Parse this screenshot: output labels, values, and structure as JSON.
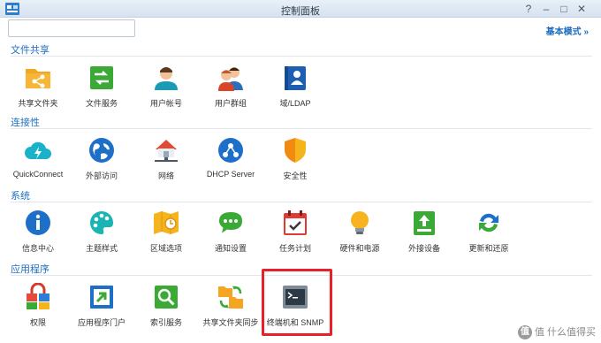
{
  "window": {
    "title": "控制面板",
    "help_icon": "help-icon",
    "minimize_icon": "minimize-icon",
    "maximize_icon": "maximize-icon",
    "close_icon": "close-icon"
  },
  "toolbar": {
    "search_value": "",
    "search_placeholder": "",
    "mode_label": "基本模式",
    "mode_chevron": "»"
  },
  "sections": [
    {
      "title": "文件共享",
      "items": [
        {
          "label": "共享文件夹",
          "icon": "shared-folder-icon"
        },
        {
          "label": "文件服务",
          "icon": "file-services-icon"
        },
        {
          "label": "用户帐号",
          "icon": "user-icon"
        },
        {
          "label": "用户群组",
          "icon": "group-icon"
        },
        {
          "label": "域/LDAP",
          "icon": "domain-ldap-icon"
        }
      ]
    },
    {
      "title": "连接性",
      "items": [
        {
          "label": "QuickConnect",
          "icon": "quickconnect-icon"
        },
        {
          "label": "外部访问",
          "icon": "external-access-icon"
        },
        {
          "label": "网络",
          "icon": "network-icon"
        },
        {
          "label": "DHCP Server",
          "icon": "dhcp-server-icon"
        },
        {
          "label": "安全性",
          "icon": "security-icon"
        }
      ]
    },
    {
      "title": "系统",
      "items": [
        {
          "label": "信息中心",
          "icon": "info-center-icon"
        },
        {
          "label": "主题样式",
          "icon": "theme-icon"
        },
        {
          "label": "区域选项",
          "icon": "regional-options-icon"
        },
        {
          "label": "通知设置",
          "icon": "notification-icon"
        },
        {
          "label": "任务计划",
          "icon": "task-scheduler-icon"
        },
        {
          "label": "硬件和电源",
          "icon": "hardware-power-icon"
        },
        {
          "label": "外接设备",
          "icon": "external-devices-icon"
        },
        {
          "label": "更新和还原",
          "icon": "update-restore-icon"
        }
      ]
    },
    {
      "title": "应用程序",
      "items": [
        {
          "label": "权限",
          "icon": "privileges-icon"
        },
        {
          "label": "应用程序门户",
          "icon": "application-portal-icon"
        },
        {
          "label": "索引服务",
          "icon": "indexing-service-icon"
        },
        {
          "label": "共享文件夹同步",
          "icon": "shared-folder-sync-icon"
        },
        {
          "label": "终端机和 SNMP",
          "icon": "terminal-snmp-icon"
        }
      ]
    }
  ],
  "watermark": {
    "text": "值 什么值得买",
    "logo": "值"
  },
  "colors": {
    "accent": "#1f6fc0",
    "highlight": "#e8202a"
  }
}
